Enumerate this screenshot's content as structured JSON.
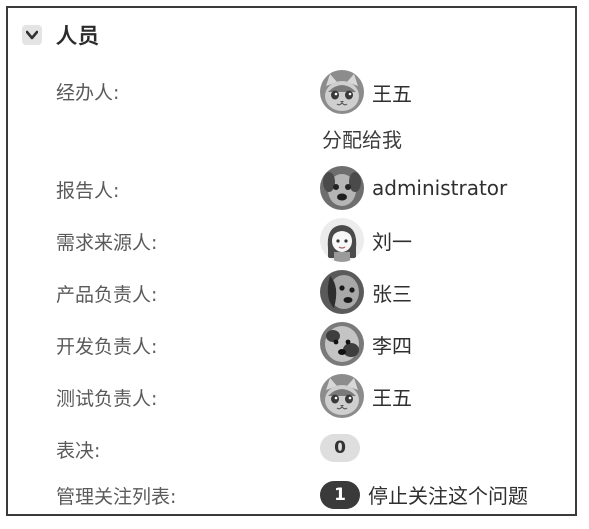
{
  "section": {
    "title": "人员",
    "toggle_icon": "chevron-down-icon"
  },
  "assignee": {
    "label": "经办人:",
    "name": "王五",
    "avatar": "cat-avatar-icon",
    "assign_to_me": "分配给我"
  },
  "reporter": {
    "label": "报告人:",
    "name": "administrator",
    "avatar": "dog-avatar-icon"
  },
  "requester": {
    "label": "需求来源人:",
    "name": "刘一",
    "avatar": "girl-avatar-icon"
  },
  "product_owner": {
    "label": "产品负责人:",
    "name": "张三",
    "avatar": "dog-avatar-icon"
  },
  "dev_owner": {
    "label": "开发负责人:",
    "name": "李四",
    "avatar": "dog-avatar-icon"
  },
  "test_owner": {
    "label": "测试负责人:",
    "name": "王五",
    "avatar": "cat-avatar-icon"
  },
  "votes": {
    "label": "表决:",
    "count": "0"
  },
  "watchers": {
    "label": "管理关注列表:",
    "count": "1",
    "action": "停止关注这个问题"
  }
}
